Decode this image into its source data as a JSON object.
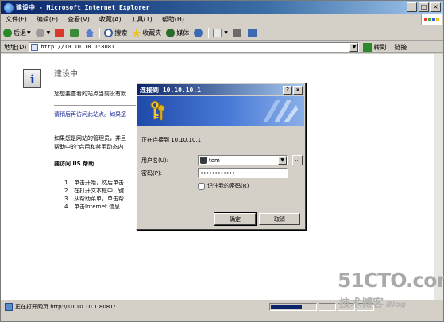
{
  "window": {
    "title": "建设中 - Microsoft Internet Explorer",
    "minimize": "_",
    "maximize": "□",
    "close": "×"
  },
  "menu": [
    "文件(F)",
    "编辑(E)",
    "查看(V)",
    "收藏(A)",
    "工具(T)",
    "帮助(H)"
  ],
  "toolbar": {
    "back": "后退",
    "search": "搜索",
    "favorites": "收藏夹",
    "media": "媒体"
  },
  "address": {
    "label": "地址(D)",
    "url": "http://10.10.10.1:8081",
    "go": "转到",
    "links": "链接"
  },
  "page": {
    "title": "建设中",
    "p1": "您想要查看的站点当前没有默",
    "p2": "请稍后再访问此站点。如果您",
    "p3_line1": "如果您是网站的管理员，并且",
    "p3_line2": "帮助中的\"启用和禁用动态内",
    "h3": "要访问 IIS 帮助",
    "list": [
      {
        "num": "1.",
        "text": "单击开始，然后单击"
      },
      {
        "num": "2.",
        "text": "在打开文本框中，键"
      },
      {
        "num": "3.",
        "text": "从帮助菜单，单击帮"
      },
      {
        "num": "4.",
        "text": "单击Internet 信息"
      }
    ]
  },
  "status": {
    "text": "正在打开网页 http://10.10.10.1:8081/...",
    "progress_fraction": 0.7
  },
  "dialog": {
    "title": "连接到 10.10.10.1",
    "help": "?",
    "close": "×",
    "connecting": "正在连接到 10.10.10.1",
    "username_label": "用户名(U):",
    "username_value": "tom",
    "password_label": "密码(P):",
    "password_value": "••••••••••••",
    "remember_label": "记住我的密码(R)",
    "remember_checked": false,
    "browse": "...",
    "ok": "确定",
    "cancel": "取消"
  },
  "watermark": {
    "main": "51CTO.com",
    "sub": "技术博客",
    "blog": "Blog"
  }
}
